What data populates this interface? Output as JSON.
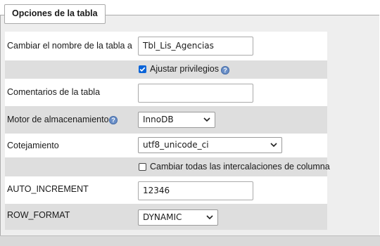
{
  "panel": {
    "title": "Opciones de la tabla"
  },
  "rename": {
    "label": "Cambiar el nombre de la tabla a",
    "value": "Tbl_Lis_Agencias"
  },
  "privileges": {
    "label": "Ajustar privilegios",
    "checked": true
  },
  "comments": {
    "label": "Comentarios de la tabla",
    "value": ""
  },
  "engine": {
    "label": "Motor de almacenamiento",
    "value": "InnoDB"
  },
  "collation": {
    "label": "Cotejamiento",
    "value": "utf8_unicode_ci"
  },
  "change_all": {
    "label": "Cambiar todas las intercalaciones de columna",
    "checked": false
  },
  "auto_increment": {
    "label": "AUTO_INCREMENT",
    "value": "12346"
  },
  "row_format": {
    "label": "ROW_FORMAT",
    "value": "DYNAMIC"
  },
  "colors": {
    "checkbox": "#0b64d8",
    "grey_row": "#dedede",
    "panel_bg": "#eeeeee"
  }
}
